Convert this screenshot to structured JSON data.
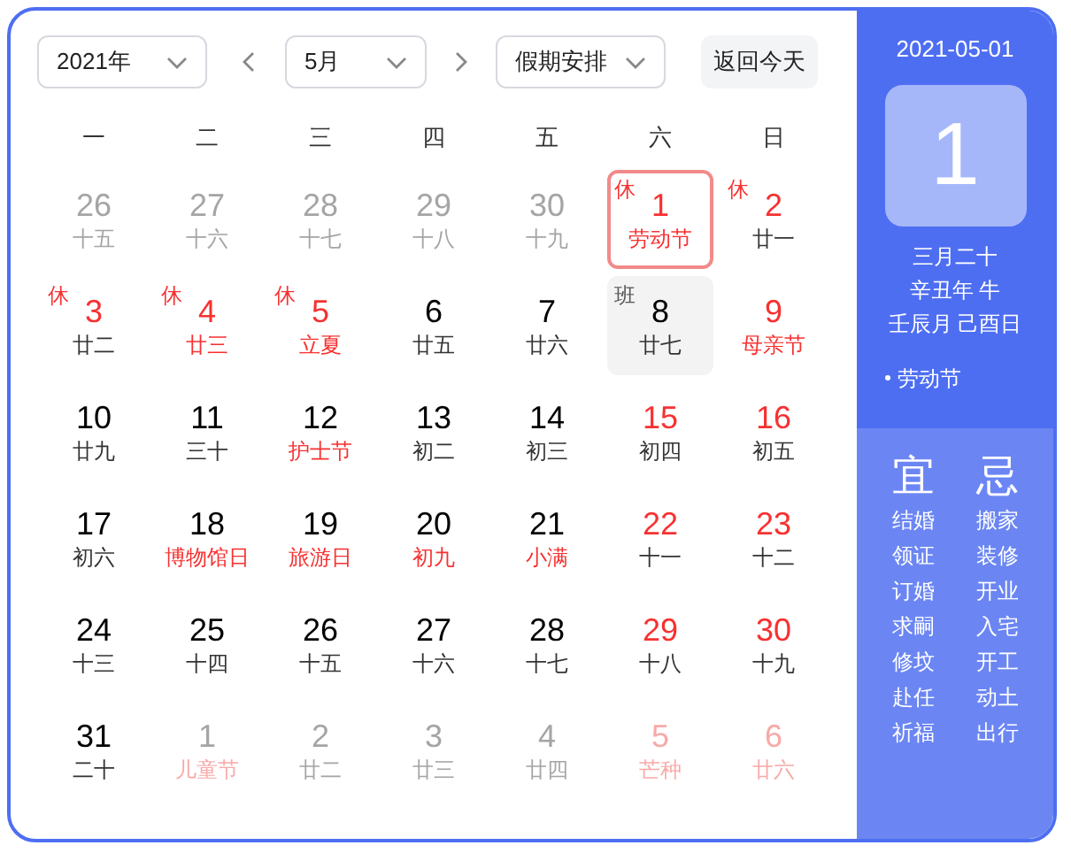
{
  "toolbar": {
    "year_select": "2021年",
    "month_select": "5月",
    "holiday_select": "假期安排",
    "today_button": "返回今天"
  },
  "weekdays": [
    "一",
    "二",
    "三",
    "四",
    "五",
    "六",
    "日"
  ],
  "weeks": [
    [
      {
        "day": "26",
        "lunar": "十五",
        "other_month": true,
        "day_red": false,
        "lunar_red": false,
        "selected": false,
        "today": false
      },
      {
        "day": "27",
        "lunar": "十六",
        "other_month": true,
        "day_red": false,
        "lunar_red": false,
        "selected": false,
        "today": false
      },
      {
        "day": "28",
        "lunar": "十七",
        "other_month": true,
        "day_red": false,
        "lunar_red": false,
        "selected": false,
        "today": false
      },
      {
        "day": "29",
        "lunar": "十八",
        "other_month": true,
        "day_red": false,
        "lunar_red": false,
        "selected": false,
        "today": false
      },
      {
        "day": "30",
        "lunar": "十九",
        "other_month": true,
        "day_red": false,
        "lunar_red": false,
        "selected": false,
        "today": false
      },
      {
        "day": "1",
        "lunar": "劳动节",
        "badge": "休",
        "other_month": false,
        "day_red": true,
        "lunar_red": true,
        "selected": true,
        "today": false
      },
      {
        "day": "2",
        "lunar": "廿一",
        "badge": "休",
        "other_month": false,
        "day_red": true,
        "lunar_red": false,
        "selected": false,
        "today": false
      }
    ],
    [
      {
        "day": "3",
        "lunar": "廿二",
        "badge": "休",
        "other_month": false,
        "day_red": true,
        "lunar_red": false,
        "selected": false,
        "today": false
      },
      {
        "day": "4",
        "lunar": "廿三",
        "badge": "休",
        "other_month": false,
        "day_red": true,
        "lunar_red": true,
        "selected": false,
        "today": false
      },
      {
        "day": "5",
        "lunar": "立夏",
        "badge": "休",
        "other_month": false,
        "day_red": true,
        "lunar_red": true,
        "selected": false,
        "today": false
      },
      {
        "day": "6",
        "lunar": "廿五",
        "other_month": false,
        "day_red": false,
        "lunar_red": false,
        "selected": false,
        "today": false
      },
      {
        "day": "7",
        "lunar": "廿六",
        "other_month": false,
        "day_red": false,
        "lunar_red": false,
        "selected": false,
        "today": false
      },
      {
        "day": "8",
        "lunar": "廿七",
        "badge": "班",
        "other_month": false,
        "day_red": false,
        "lunar_red": false,
        "selected": false,
        "today": true
      },
      {
        "day": "9",
        "lunar": "母亲节",
        "other_month": false,
        "day_red": true,
        "lunar_red": true,
        "selected": false,
        "today": false
      }
    ],
    [
      {
        "day": "10",
        "lunar": "廿九",
        "other_month": false,
        "day_red": false,
        "lunar_red": false,
        "selected": false,
        "today": false
      },
      {
        "day": "11",
        "lunar": "三十",
        "other_month": false,
        "day_red": false,
        "lunar_red": false,
        "selected": false,
        "today": false
      },
      {
        "day": "12",
        "lunar": "护士节",
        "other_month": false,
        "day_red": false,
        "lunar_red": true,
        "selected": false,
        "today": false
      },
      {
        "day": "13",
        "lunar": "初二",
        "other_month": false,
        "day_red": false,
        "lunar_red": false,
        "selected": false,
        "today": false
      },
      {
        "day": "14",
        "lunar": "初三",
        "other_month": false,
        "day_red": false,
        "lunar_red": false,
        "selected": false,
        "today": false
      },
      {
        "day": "15",
        "lunar": "初四",
        "other_month": false,
        "day_red": true,
        "lunar_red": false,
        "selected": false,
        "today": false
      },
      {
        "day": "16",
        "lunar": "初五",
        "other_month": false,
        "day_red": true,
        "lunar_red": false,
        "selected": false,
        "today": false
      }
    ],
    [
      {
        "day": "17",
        "lunar": "初六",
        "other_month": false,
        "day_red": false,
        "lunar_red": false,
        "selected": false,
        "today": false
      },
      {
        "day": "18",
        "lunar": "博物馆日",
        "other_month": false,
        "day_red": false,
        "lunar_red": true,
        "selected": false,
        "today": false
      },
      {
        "day": "19",
        "lunar": "旅游日",
        "other_month": false,
        "day_red": false,
        "lunar_red": true,
        "selected": false,
        "today": false
      },
      {
        "day": "20",
        "lunar": "初九",
        "other_month": false,
        "day_red": false,
        "lunar_red": true,
        "selected": false,
        "today": false
      },
      {
        "day": "21",
        "lunar": "小满",
        "other_month": false,
        "day_red": false,
        "lunar_red": true,
        "selected": false,
        "today": false
      },
      {
        "day": "22",
        "lunar": "十一",
        "other_month": false,
        "day_red": true,
        "lunar_red": false,
        "selected": false,
        "today": false
      },
      {
        "day": "23",
        "lunar": "十二",
        "other_month": false,
        "day_red": true,
        "lunar_red": false,
        "selected": false,
        "today": false
      }
    ],
    [
      {
        "day": "24",
        "lunar": "十三",
        "other_month": false,
        "day_red": false,
        "lunar_red": false,
        "selected": false,
        "today": false
      },
      {
        "day": "25",
        "lunar": "十四",
        "other_month": false,
        "day_red": false,
        "lunar_red": false,
        "selected": false,
        "today": false
      },
      {
        "day": "26",
        "lunar": "十五",
        "other_month": false,
        "day_red": false,
        "lunar_red": false,
        "selected": false,
        "today": false
      },
      {
        "day": "27",
        "lunar": "十六",
        "other_month": false,
        "day_red": false,
        "lunar_red": false,
        "selected": false,
        "today": false
      },
      {
        "day": "28",
        "lunar": "十七",
        "other_month": false,
        "day_red": false,
        "lunar_red": false,
        "selected": false,
        "today": false
      },
      {
        "day": "29",
        "lunar": "十八",
        "other_month": false,
        "day_red": true,
        "lunar_red": false,
        "selected": false,
        "today": false
      },
      {
        "day": "30",
        "lunar": "十九",
        "other_month": false,
        "day_red": true,
        "lunar_red": false,
        "selected": false,
        "today": false
      }
    ],
    [
      {
        "day": "31",
        "lunar": "二十",
        "other_month": false,
        "day_red": false,
        "lunar_red": false,
        "selected": false,
        "today": false
      },
      {
        "day": "1",
        "lunar": "儿童节",
        "other_month": true,
        "day_red": false,
        "lunar_red": true,
        "selected": false,
        "today": false
      },
      {
        "day": "2",
        "lunar": "廿二",
        "other_month": true,
        "day_red": false,
        "lunar_red": false,
        "selected": false,
        "today": false
      },
      {
        "day": "3",
        "lunar": "廿三",
        "other_month": true,
        "day_red": false,
        "lunar_red": false,
        "selected": false,
        "today": false
      },
      {
        "day": "4",
        "lunar": "廿四",
        "other_month": true,
        "day_red": false,
        "lunar_red": false,
        "selected": false,
        "today": false
      },
      {
        "day": "5",
        "lunar": "芒种",
        "other_month": true,
        "day_red": true,
        "lunar_red": true,
        "selected": false,
        "today": false
      },
      {
        "day": "6",
        "lunar": "廿六",
        "other_month": true,
        "day_red": true,
        "lunar_red": true,
        "selected": false,
        "today": false
      }
    ]
  ],
  "detail": {
    "date": "2021-05-01",
    "big_day": "1",
    "lunar_lines": [
      "三月二十",
      "辛丑年 牛",
      "壬辰月 己酉日"
    ],
    "festivals": [
      "劳动节"
    ],
    "yi": {
      "title": "宜",
      "items": [
        "结婚",
        "领证",
        "订婚",
        "求嗣",
        "修坟",
        "赴任",
        "祈福"
      ]
    },
    "ji": {
      "title": "忌",
      "items": [
        "搬家",
        "装修",
        "开业",
        "入宅",
        "开工",
        "动土",
        "出行"
      ]
    }
  }
}
